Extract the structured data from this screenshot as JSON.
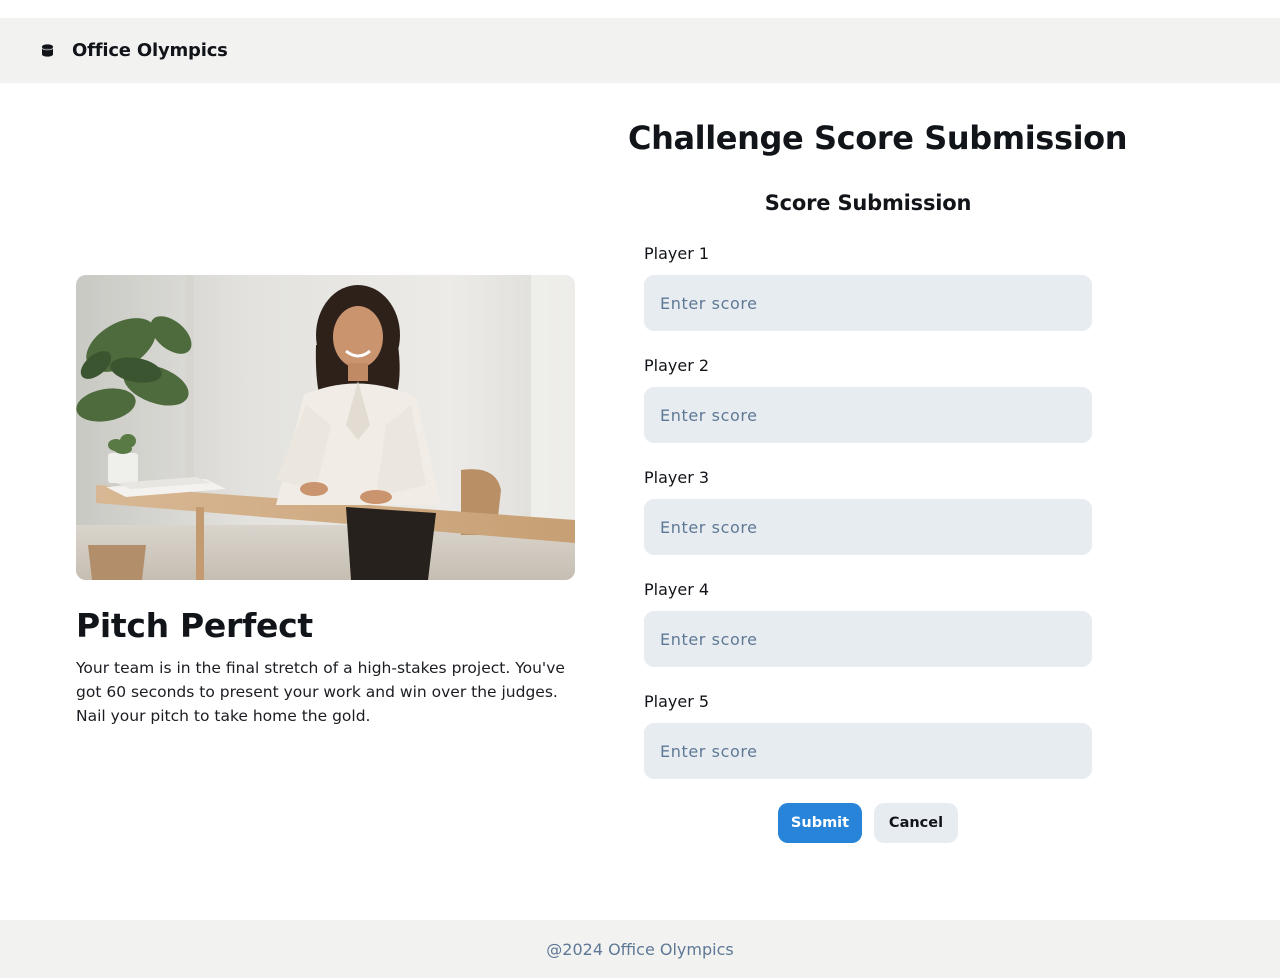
{
  "header": {
    "brand_name": "Office Olympics",
    "logo_icon": "database-icon"
  },
  "challenge": {
    "image_alt": "Smiling woman seated at a wooden desk in a bright office with plants",
    "title": "Pitch Perfect",
    "description": "Your team is in the final stretch of a high-stakes project. You've got 60 seconds to present your work and win over the judges. Nail your pitch to take home the gold."
  },
  "form": {
    "page_title": "Challenge Score Submission",
    "section_title": "Score Submission",
    "fields": [
      {
        "label": "Player 1",
        "placeholder": "Enter score",
        "value": ""
      },
      {
        "label": "Player 2",
        "placeholder": "Enter score",
        "value": ""
      },
      {
        "label": "Player 3",
        "placeholder": "Enter score",
        "value": ""
      },
      {
        "label": "Player 4",
        "placeholder": "Enter score",
        "value": ""
      },
      {
        "label": "Player 5",
        "placeholder": "Enter score",
        "value": ""
      }
    ],
    "submit_label": "Submit",
    "cancel_label": "Cancel"
  },
  "footer": {
    "text": "@2024 Office Olympics"
  },
  "colors": {
    "accent": "#2784d8",
    "input_bg": "#e7ecf1",
    "placeholder": "#5e7896",
    "bar_bg": "#f2f2f1"
  }
}
